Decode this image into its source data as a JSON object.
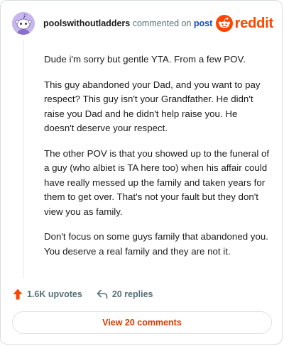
{
  "comment": {
    "username": "poolswithoutladders",
    "action_text": "commented on",
    "post_link_text": "post",
    "paragraphs": [
      "Dude i'm sorry but gentle YTA. From a few POV.",
      "This guy abandoned your Dad, and you want to pay respect? This guy isn't your Grandfather. He didn't raise you Dad and he didn't help raise you. He doesn't deserve your respect.",
      "The other POV is that you showed up to the funeral of a guy (who albiet is TA here too) when his affair could have really messed up the family and taken years for them to get over. That's not your fault but they don't view you as family.",
      "Don't focus on some guys family that abandoned you. You deserve a real family and they are not it."
    ]
  },
  "brand": {
    "word": "reddit",
    "icon": "reddit-snoo-icon",
    "color": "#ff4500"
  },
  "footer": {
    "upvotes": "1.6K upvotes",
    "replies": "20 replies",
    "upvote_icon": "upvote-arrow-icon",
    "reply_icon": "reply-arrow-icon"
  },
  "view_button": {
    "label": "View 20 comments"
  },
  "colors": {
    "accent": "#ff4500",
    "link": "#0a4bd1",
    "muted": "#576f76",
    "avatar_bg": "#c8b6f0"
  }
}
